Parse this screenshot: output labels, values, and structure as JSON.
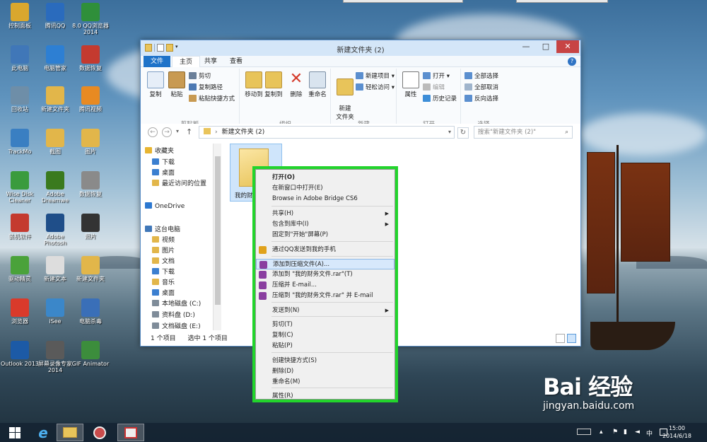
{
  "desktop": {
    "icons": [
      {
        "label": "控制面板",
        "color": "#d9a72e"
      },
      {
        "label": "腾讯QQ",
        "color": "#2a6bbd"
      },
      {
        "label": "8.0 QQ浏览器 2014",
        "color": "#2f8f3a"
      },
      {
        "label": "此电脑",
        "color": "#4077b8"
      },
      {
        "label": "电脑管家",
        "color": "#2d7fd3"
      },
      {
        "label": "数据恢复",
        "color": "#c43a2f"
      },
      {
        "label": "回收站",
        "color": "#6e8ea8"
      },
      {
        "label": "新建文件夹",
        "color": "#e2b64a"
      },
      {
        "label": "腾讯视频",
        "color": "#e88a22"
      },
      {
        "label": "TrackMo",
        "color": "#3a7fc2"
      },
      {
        "label": "截图",
        "color": "#e2b64a"
      },
      {
        "label": "图片",
        "color": "#e2b64a"
      },
      {
        "label": "Wise Disk Cleaner",
        "color": "#3a9b3d"
      },
      {
        "label": "Adobe Dreamwe",
        "color": "#3a7a1e"
      },
      {
        "label": "数据恢复",
        "color": "#8a8a8a"
      },
      {
        "label": "装机软件",
        "color": "#c43a2f"
      },
      {
        "label": "Adobe Photosh",
        "color": "#1f4e89"
      },
      {
        "label": "照片",
        "color": "#333333"
      },
      {
        "label": "驱动精灵",
        "color": "#4aa23a"
      },
      {
        "label": "新建文本",
        "color": "#dddddd"
      },
      {
        "label": "新建文件夹",
        "color": "#e2b64a"
      },
      {
        "label": "浏览器",
        "color": "#d93a2b"
      },
      {
        "label": "iSee",
        "color": "#3b87c9"
      },
      {
        "label": "电脑杀毒",
        "color": "#3a6fb8"
      },
      {
        "label": "Outlook 2013",
        "color": "#1c5aa6"
      },
      {
        "label": "屏幕录像专家 2014",
        "color": "#5a5a5a"
      },
      {
        "label": "GIF Animator",
        "color": "#3c8d3c"
      }
    ]
  },
  "window": {
    "title": "新建文件夹 (2)",
    "tabs": {
      "file": "文件",
      "home": "主页",
      "share": "共享",
      "view": "查看"
    },
    "ribbon": {
      "copy": "复制",
      "paste": "粘贴",
      "cut": "剪切",
      "copy_path": "复制路径",
      "paste_shortcut": "粘贴快捷方式",
      "group_clipboard": "剪贴板",
      "move_to": "移动到",
      "copy_to": "复制到",
      "delete": "删除",
      "rename": "重命名",
      "group_organize": "组织",
      "new_folder": "新建\n文件夹",
      "new_item": "新建项目",
      "easy_access": "轻松访问",
      "group_new": "新建",
      "properties": "属性",
      "open": "打开",
      "edit": "编辑",
      "history": "历史记录",
      "group_open": "打开",
      "select_all": "全部选择",
      "select_none": "全部取消",
      "invert": "反向选择",
      "group_select": "选择"
    },
    "address": "新建文件夹 (2)",
    "search_placeholder": "搜索\"新建文件夹 (2)\"",
    "nav": [
      {
        "label": "收藏夹",
        "color": "#e8b531"
      },
      {
        "label": "下载",
        "color": "#3b7fd0"
      },
      {
        "label": "桌面",
        "color": "#3b7fd0"
      },
      {
        "label": "最近访问的位置",
        "color": "#e2b64a"
      },
      {
        "label": "OneDrive",
        "color": "#2c78d0"
      },
      {
        "label": "这台电脑",
        "color": "#4077b8"
      },
      {
        "label": "视频",
        "color": "#e2b64a"
      },
      {
        "label": "图片",
        "color": "#e2b64a"
      },
      {
        "label": "文档",
        "color": "#e2b64a"
      },
      {
        "label": "下载",
        "color": "#3b7fd0"
      },
      {
        "label": "音乐",
        "color": "#e2b64a"
      },
      {
        "label": "桌面",
        "color": "#3b7fd0"
      },
      {
        "label": "本地磁盘 (C:)",
        "color": "#7f8c99"
      },
      {
        "label": "资料盘 (D:)",
        "color": "#7f8c99"
      },
      {
        "label": "文档磁盘 (E:)",
        "color": "#7f8c99"
      }
    ],
    "file_name": "我的财",
    "status_count": "1 个项目",
    "status_selected": "选中 1 个项目"
  },
  "context_menu": {
    "items": [
      {
        "label": "打开(O)"
      },
      {
        "label": "在新窗口中打开(E)"
      },
      {
        "label": "Browse in Adobe Bridge CS6"
      },
      {
        "label": "共享(H)"
      },
      {
        "label": "包含到库中(I)"
      },
      {
        "label": "固定到\"开始\"屏幕(P)"
      },
      {
        "label": "通过QQ发送到我的手机"
      },
      {
        "label": "添加到压缩文件(A)..."
      },
      {
        "label": "添加到 \"我的财务文件.rar\"(T)"
      },
      {
        "label": "压缩并 E-mail..."
      },
      {
        "label": "压缩到 \"我的财务文件.rar\" 并 E-mail"
      },
      {
        "label": "发送到(N)"
      },
      {
        "label": "剪切(T)"
      },
      {
        "label": "复制(C)"
      },
      {
        "label": "粘贴(P)"
      },
      {
        "label": "创建快捷方式(S)"
      },
      {
        "label": "删除(D)"
      },
      {
        "label": "重命名(M)"
      },
      {
        "label": "属性(R)"
      }
    ]
  },
  "taskbar": {
    "time": "15:00",
    "date": "2014/6/18",
    "ime": "中"
  },
  "watermark": {
    "logo": "Bai 经验",
    "url": "jingyan.baidu.com"
  }
}
